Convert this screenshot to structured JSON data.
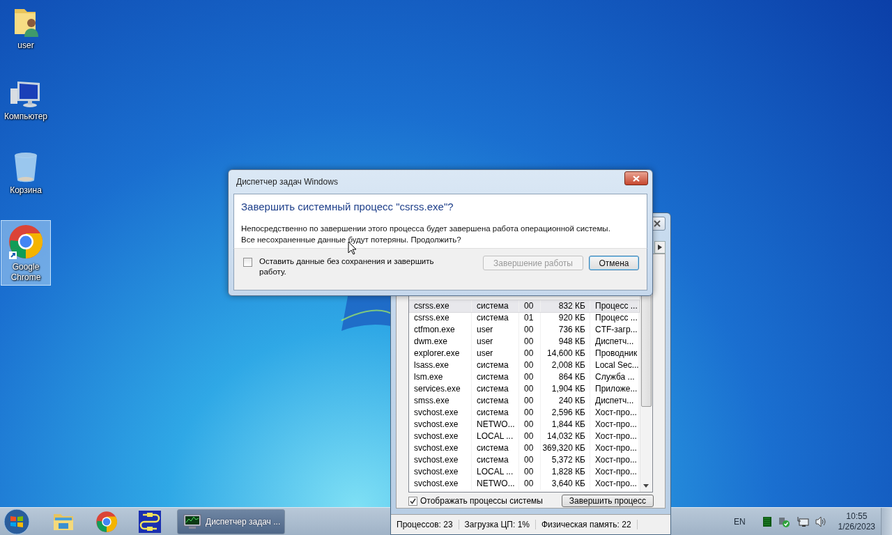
{
  "desktop_icons": [
    {
      "kind": "user-folder",
      "label": "user",
      "selected": false
    },
    {
      "kind": "computer",
      "label": "Компьютер",
      "selected": false
    },
    {
      "kind": "recycle-bin",
      "label": "Корзина",
      "selected": false
    },
    {
      "kind": "chrome",
      "label": "Google\nChrome",
      "selected": true
    }
  ],
  "task_manager": {
    "process_table": {
      "rows": [
        {
          "cells": [
            "csrss.exe",
            "система",
            "00",
            "832 КБ",
            "Процесс ..."
          ],
          "selected": true
        },
        {
          "cells": [
            "csrss.exe",
            "система",
            "01",
            "920 КБ",
            "Процесс ..."
          ],
          "selected": false
        },
        {
          "cells": [
            "ctfmon.exe",
            "user",
            "00",
            "736 КБ",
            "CTF-загр..."
          ],
          "selected": false
        },
        {
          "cells": [
            "dwm.exe",
            "user",
            "00",
            "948 КБ",
            "Диспетч..."
          ],
          "selected": false
        },
        {
          "cells": [
            "explorer.exe",
            "user",
            "00",
            "14,600 КБ",
            "Проводник"
          ],
          "selected": false
        },
        {
          "cells": [
            "lsass.exe",
            "система",
            "00",
            "2,008 КБ",
            "Local Sec..."
          ],
          "selected": false
        },
        {
          "cells": [
            "lsm.exe",
            "система",
            "00",
            "864 КБ",
            "Служба ..."
          ],
          "selected": false
        },
        {
          "cells": [
            "services.exe",
            "система",
            "00",
            "1,904 КБ",
            "Приложе..."
          ],
          "selected": false
        },
        {
          "cells": [
            "smss.exe",
            "система",
            "00",
            "240 КБ",
            "Диспетч..."
          ],
          "selected": false
        },
        {
          "cells": [
            "svchost.exe",
            "система",
            "00",
            "2,596 КБ",
            "Хост-про..."
          ],
          "selected": false
        },
        {
          "cells": [
            "svchost.exe",
            "NETWO...",
            "00",
            "1,844 КБ",
            "Хост-про..."
          ],
          "selected": false
        },
        {
          "cells": [
            "svchost.exe",
            "LOCAL ...",
            "00",
            "14,032 КБ",
            "Хост-про..."
          ],
          "selected": false
        },
        {
          "cells": [
            "svchost.exe",
            "система",
            "00",
            "369,320 КБ",
            "Хост-про..."
          ],
          "selected": false
        },
        {
          "cells": [
            "svchost.exe",
            "система",
            "00",
            "5,372 КБ",
            "Хост-про..."
          ],
          "selected": false
        },
        {
          "cells": [
            "svchost.exe",
            "LOCAL ...",
            "00",
            "1,828 КБ",
            "Хост-про..."
          ],
          "selected": false
        },
        {
          "cells": [
            "svchost.exe",
            "NETWO...",
            "00",
            "3,640 КБ",
            "Хост-про..."
          ],
          "selected": false
        }
      ]
    },
    "show_all_processes": {
      "label": "Отображать процессы системы",
      "checked": true
    },
    "end_process_button": "Завершить процесс",
    "status_bar": [
      "Процессов: 23",
      "Загрузка ЦП: 1%",
      "Физическая память: 22"
    ]
  },
  "dialog": {
    "title": "Диспетчер задач Windows",
    "heading": "Завершить системный процесс \"csrss.exe\"?",
    "message": "Непосредственно по завершении этого процесса будет завершена работа операционной системы.\nВсе несохраненные данные будут потеряны.  Продолжить?",
    "checkbox": {
      "label": "Оставить данные без сохранения и завершить работу.",
      "checked": false
    },
    "buttons": [
      {
        "label": "Завершение работы",
        "disabled": true,
        "default": false
      },
      {
        "label": "Отмена",
        "disabled": false,
        "default": true
      }
    ]
  },
  "taskbar": {
    "pinned": [
      {
        "kind": "explorer"
      },
      {
        "kind": "chrome"
      },
      {
        "kind": "network-app"
      }
    ],
    "windows": [
      {
        "label": "Диспетчер задач ...",
        "selected": true
      }
    ],
    "language": "EN",
    "time": "10:55",
    "date": "1/26/2023"
  }
}
